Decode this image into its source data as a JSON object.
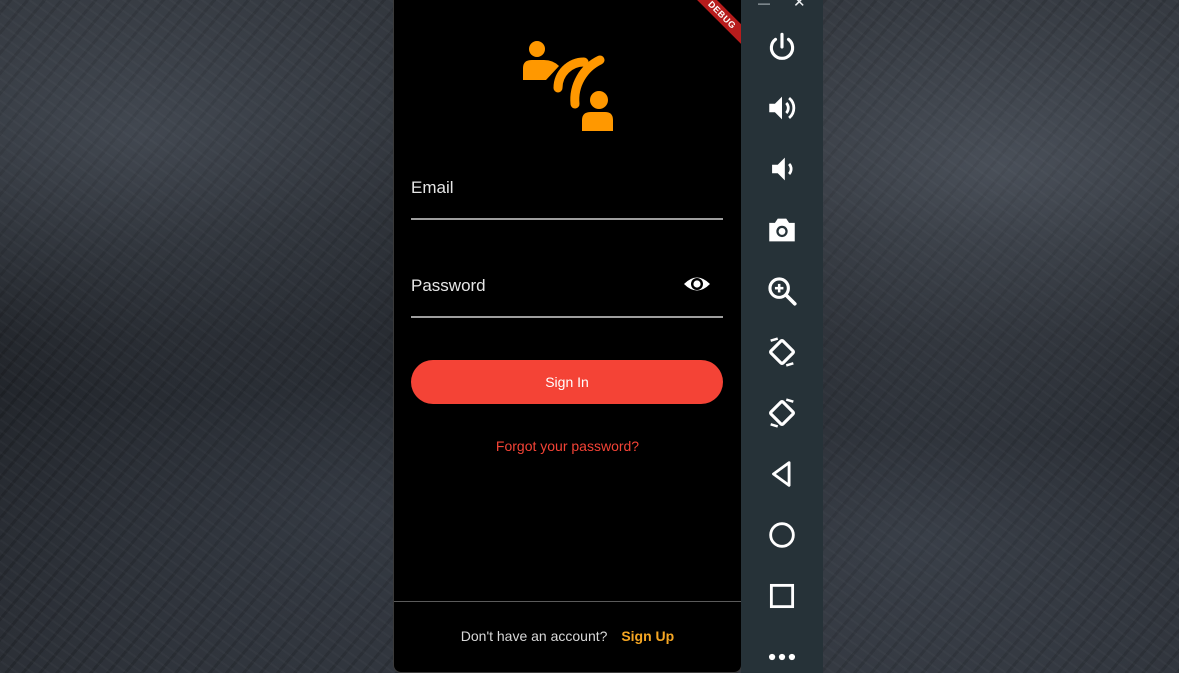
{
  "app": {
    "debug_banner": "DEBUG",
    "email_label": "Email",
    "password_label": "Password",
    "sign_in_label": "Sign In",
    "forgot_label": "Forgot your password?",
    "footer_text": "Don't have an account?",
    "signup_label": "Sign Up"
  },
  "colors": {
    "accent_red": "#f44336",
    "accent_orange": "#f5a623",
    "logo_orange": "#ff9800",
    "toolbar_bg": "#263238"
  },
  "toolbar": {
    "window_controls": [
      "minimize-icon",
      "close-icon"
    ],
    "buttons": [
      "power-icon",
      "volume-up-icon",
      "volume-down-icon",
      "camera-icon",
      "zoom-in-icon",
      "rotate-left-icon",
      "rotate-right-icon",
      "back-icon",
      "home-icon",
      "overview-icon",
      "more-icon"
    ]
  }
}
